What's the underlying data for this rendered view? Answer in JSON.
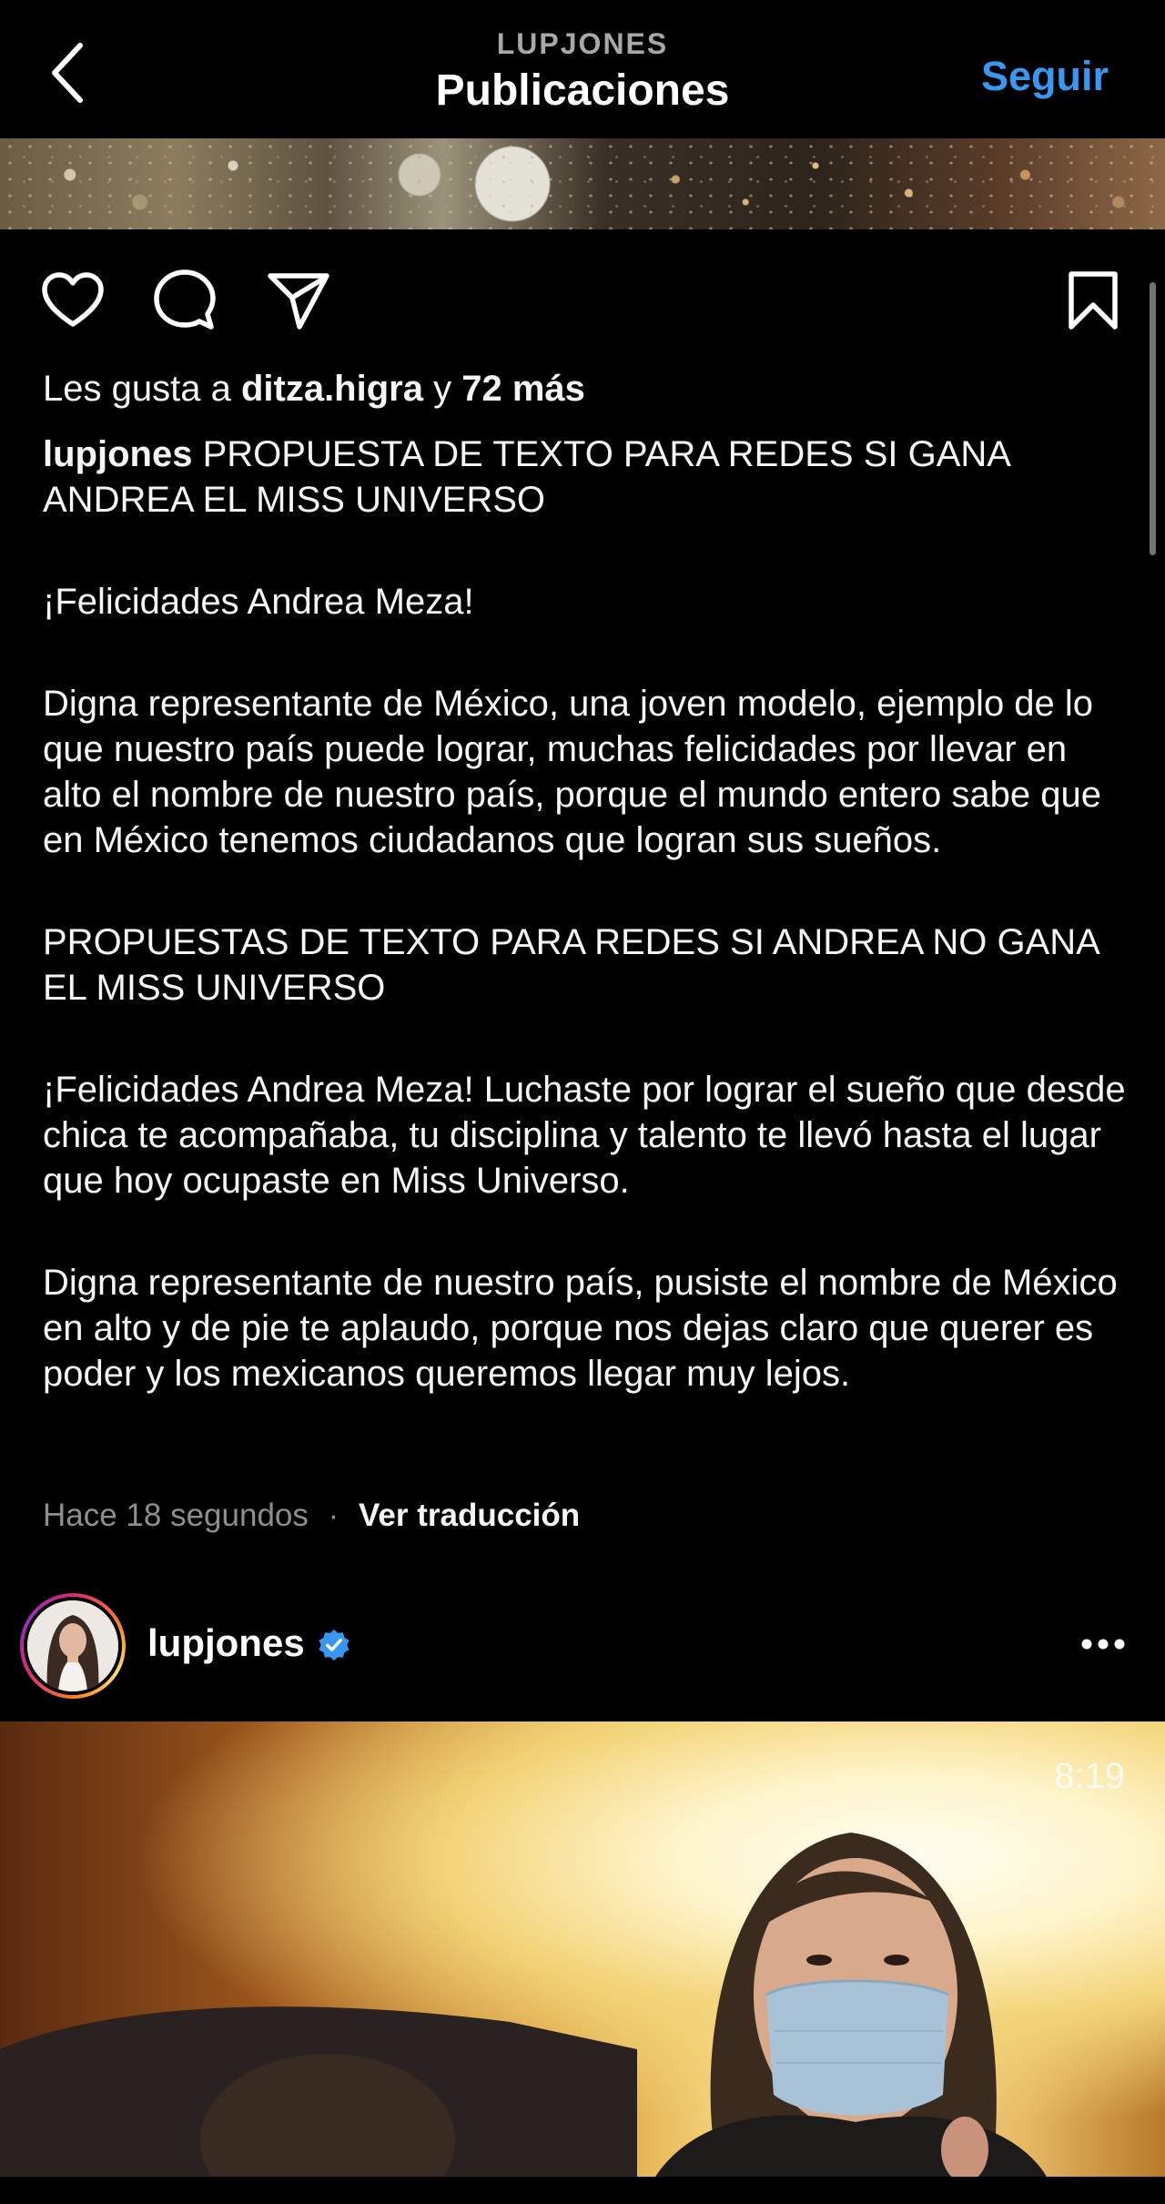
{
  "header": {
    "account": "LUPJONES",
    "title": "Publicaciones",
    "follow_label": "Seguir"
  },
  "actions": {
    "icons": [
      "heart-icon",
      "comment-icon",
      "share-icon",
      "bookmark-icon"
    ]
  },
  "likes": {
    "prefix": "Les gusta a",
    "user": "ditza.higra",
    "connector": "y",
    "count": "72 más"
  },
  "caption": {
    "username": "lupjones",
    "paragraphs": [
      "PROPUESTA DE TEXTO PARA REDES SI GANA ANDREA EL MISS UNIVERSO",
      "¡Felicidades Andrea Meza!",
      "Digna representante de México, una joven modelo, ejemplo de lo que nuestro país puede lograr, muchas felicidades por llevar en alto el nombre de nuestro país, porque el mundo entero sabe que en México tenemos ciudadanos que logran sus sueños.",
      "PROPUESTAS DE TEXTO PARA REDES SI ANDREA NO GANA EL MISS UNIVERSO",
      "¡Felicidades Andrea Meza! Luchaste por lograr el sueño que desde chica te acompañaba, tu disciplina y talento te llevó hasta el lugar que hoy ocupaste en Miss Universo.",
      "Digna representante de nuestro país, pusiste el nombre de México en alto y de pie te aplaudo, porque nos dejas claro que querer es poder y los mexicanos queremos llegar muy lejos."
    ]
  },
  "meta": {
    "time": "Hace 18 segundos",
    "separator": "·",
    "translate_label": "Ver traducción"
  },
  "next_post": {
    "username": "lupjones",
    "verified": true,
    "video_time": "8:19"
  },
  "colors": {
    "background": "#000000",
    "accent": "#3897f0",
    "muted": "#8e8e8e",
    "text": "#f5f5f5"
  }
}
